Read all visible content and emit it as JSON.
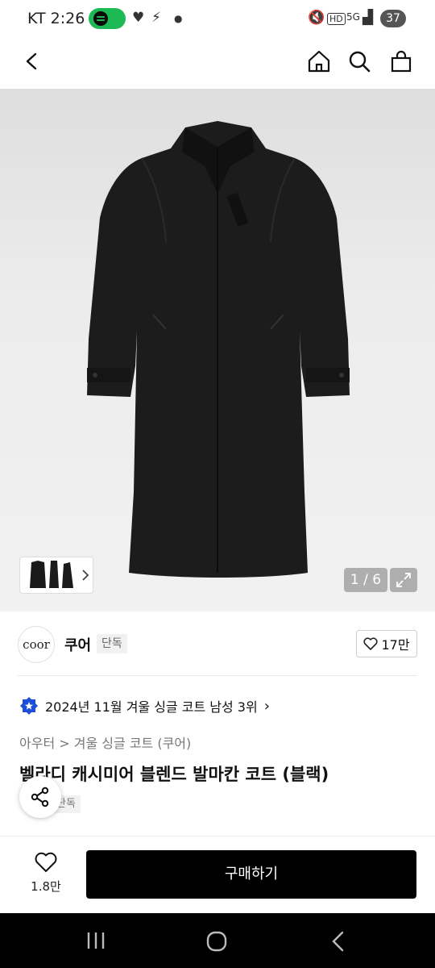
{
  "status_bar": {
    "carrier_time": "KT 2:26",
    "battery": "37",
    "network": "5G"
  },
  "header": {
    "back_icon": "back-arrow-icon",
    "home_icon": "home-icon",
    "search_icon": "search-icon",
    "cart_icon": "shopping-bag-icon"
  },
  "gallery": {
    "counter": "1 / 6",
    "current_index": 1,
    "total": 6
  },
  "brand": {
    "logo_text": "coor",
    "name": "쿠어",
    "badge": "단독",
    "likes": "17만"
  },
  "ranking": {
    "text": "2024년 11월 겨울 싱글 코트 남성 3위"
  },
  "breadcrumb": {
    "category": "아우터",
    "sub": "겨울 싱글 코트 (쿠어)",
    "separator": ">"
  },
  "product": {
    "title": "벨라디 캐시미어 블렌드 발마칸 코트 (블랙)",
    "badge": "단독"
  },
  "actions": {
    "wish_count": "1.8만",
    "buy_label": "구매하기"
  },
  "colors": {
    "accent": "#000000",
    "rank_badge": "#1e4fd8"
  }
}
